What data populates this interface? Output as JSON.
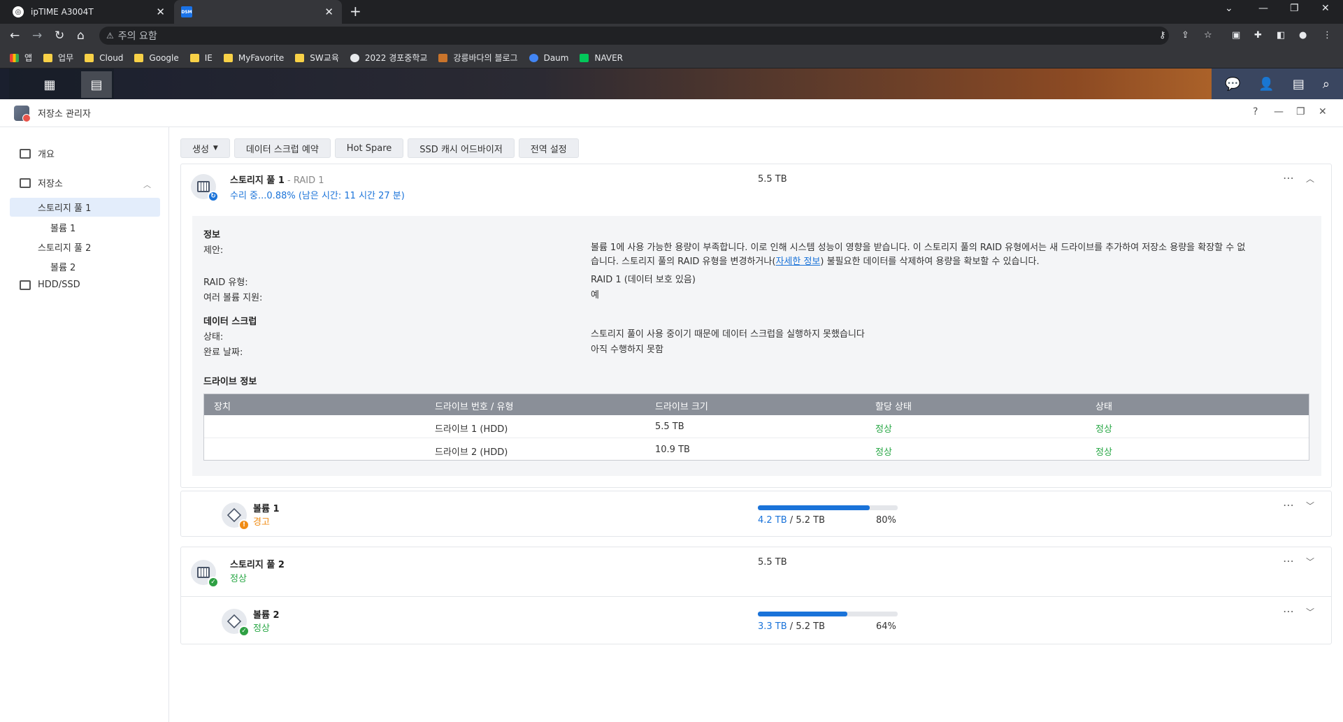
{
  "browser": {
    "tabs": [
      {
        "title": "ipTIME A3004T"
      },
      {
        "title": "",
        "favicon_text": "DSM"
      }
    ],
    "address": {
      "warning": "주의 요함",
      "url": ""
    },
    "bookmarks": [
      {
        "label": "앱",
        "icon": "apps-icon"
      },
      {
        "label": "업무",
        "icon": "folder-icon"
      },
      {
        "label": "Cloud",
        "icon": "folder-icon"
      },
      {
        "label": "Google",
        "icon": "folder-icon"
      },
      {
        "label": "IE",
        "icon": "folder-icon"
      },
      {
        "label": "MyFavorite",
        "icon": "folder-icon"
      },
      {
        "label": "SW교육",
        "icon": "folder-icon"
      },
      {
        "label": "2022 경포중학교",
        "icon": "globe-icon"
      },
      {
        "label": "강릉바다의 블로그",
        "icon": "image-icon"
      },
      {
        "label": "Daum",
        "icon": "daum-icon"
      },
      {
        "label": "NAVER",
        "icon": "naver-icon"
      }
    ]
  },
  "app": {
    "title": "저장소 관리자",
    "window_buttons": {
      "help": "?",
      "minimize": "—",
      "maximize": "❐",
      "close": "✕"
    }
  },
  "sidebar": {
    "overview": "개요",
    "storage": "저장소",
    "pool1": "스토리지 풀 1",
    "volume1": "볼륨 1",
    "pool2": "스토리지 풀 2",
    "volume2": "볼륨 2",
    "hdd": "HDD/SSD"
  },
  "toolbar": {
    "create": "생성",
    "scrub_schedule": "데이터 스크럽 예약",
    "hot_spare": "Hot Spare",
    "ssd_advisor": "SSD 캐시 어드바이저",
    "global_settings": "전역 설정"
  },
  "pool1": {
    "title": "스토리지 풀 1",
    "raid": " - RAID 1",
    "status": "수리 중...0.88% (남은 시간: 11 시간 27 분)",
    "size": "5.5 TB",
    "info_head": "정보",
    "suggest_label": "제안:",
    "suggest_text_1": "볼륨 1에 사용 가능한 용량이 부족합니다. 이로 인해 시스템 성능이 영향을 받습니다. 이 스토리지 풀의 RAID 유형에서는 새 드라이브를 추가하여 저장소 용량을 확장할 수 없",
    "suggest_text_2a": "습니다. 스토리지 풀의 RAID 유형을 변경하거나(",
    "suggest_link": "자세한 정보",
    "suggest_text_2b": ") 불필요한 데이터를 삭제하여 용량을 확보할 수 있습니다.",
    "raid_label": "RAID 유형:",
    "raid_value": "RAID 1 (데이터 보호 있음)",
    "multi_label": "여러 볼륨 지원:",
    "multi_value": "예",
    "scrub_head": "데이터 스크럽",
    "state_label": "상태:",
    "state_value": "스토리지 풀이 사용 중이기 때문에 데이터 스크럽을 실행하지 못했습니다",
    "done_label": "완료 날짜:",
    "done_value": "아직 수행하지 못함",
    "drive_head": "드라이브 정보",
    "table": {
      "headers": [
        "장치",
        "드라이브 번호 / 유형",
        "드라이브 크기",
        "할당 상태",
        "상태"
      ],
      "rows": [
        {
          "device": "",
          "drive": "드라이브 1 (HDD)",
          "size": "5.5 TB",
          "alloc": "정상",
          "state": "정상"
        },
        {
          "device": "",
          "drive": "드라이브 2 (HDD)",
          "size": "10.9 TB",
          "alloc": "정상",
          "state": "정상"
        }
      ]
    }
  },
  "volume1": {
    "title": "볼륨 1",
    "status": "경고",
    "used": "4.2 TB",
    "total": " / 5.2 TB",
    "percent": "80%",
    "usage_fraction": 0.8
  },
  "pool2": {
    "title": "스토리지 풀 2",
    "status": "정상",
    "size": "5.5 TB"
  },
  "volume2": {
    "title": "볼륨 2",
    "status": "정상",
    "used": "3.3 TB",
    "total": " / 5.2 TB",
    "percent": "64%",
    "usage_fraction": 0.64
  },
  "colors": {
    "accent": "#1a73d9",
    "ok": "#28a745",
    "warning": "#f08c15"
  }
}
